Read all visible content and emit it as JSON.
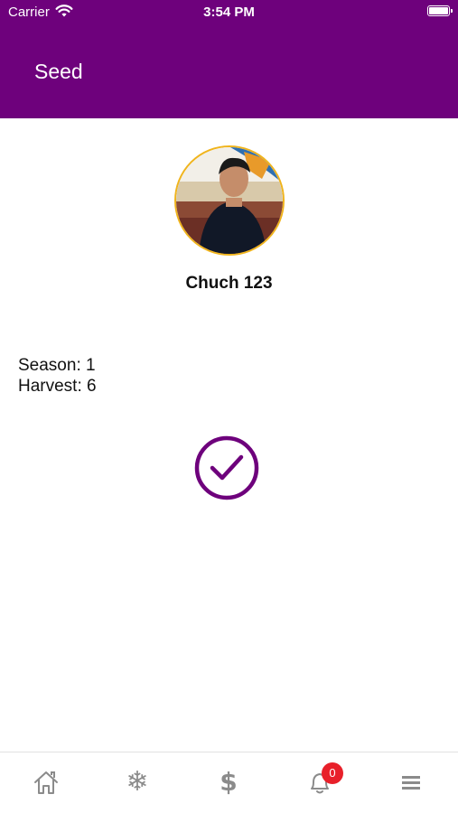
{
  "status_bar": {
    "carrier": "Carrier",
    "time": "3:54 PM"
  },
  "header": {
    "title": "Seed"
  },
  "profile": {
    "username": "Chuch 123",
    "season_label": "Season: 1",
    "harvest_label": "Harvest: 6"
  },
  "action": {
    "icon": "checkmark-circle-icon"
  },
  "tab_bar": {
    "items": [
      {
        "icon": "home-icon"
      },
      {
        "icon": "snowflake-icon"
      },
      {
        "icon": "dollar-icon"
      },
      {
        "icon": "bell-icon",
        "badge": "0"
      },
      {
        "icon": "menu-icon"
      }
    ]
  },
  "colors": {
    "primary": "#6e017c",
    "avatar_border": "#f0b41c",
    "badge": "#e8202a",
    "tab_icon": "#8b8b8b"
  }
}
